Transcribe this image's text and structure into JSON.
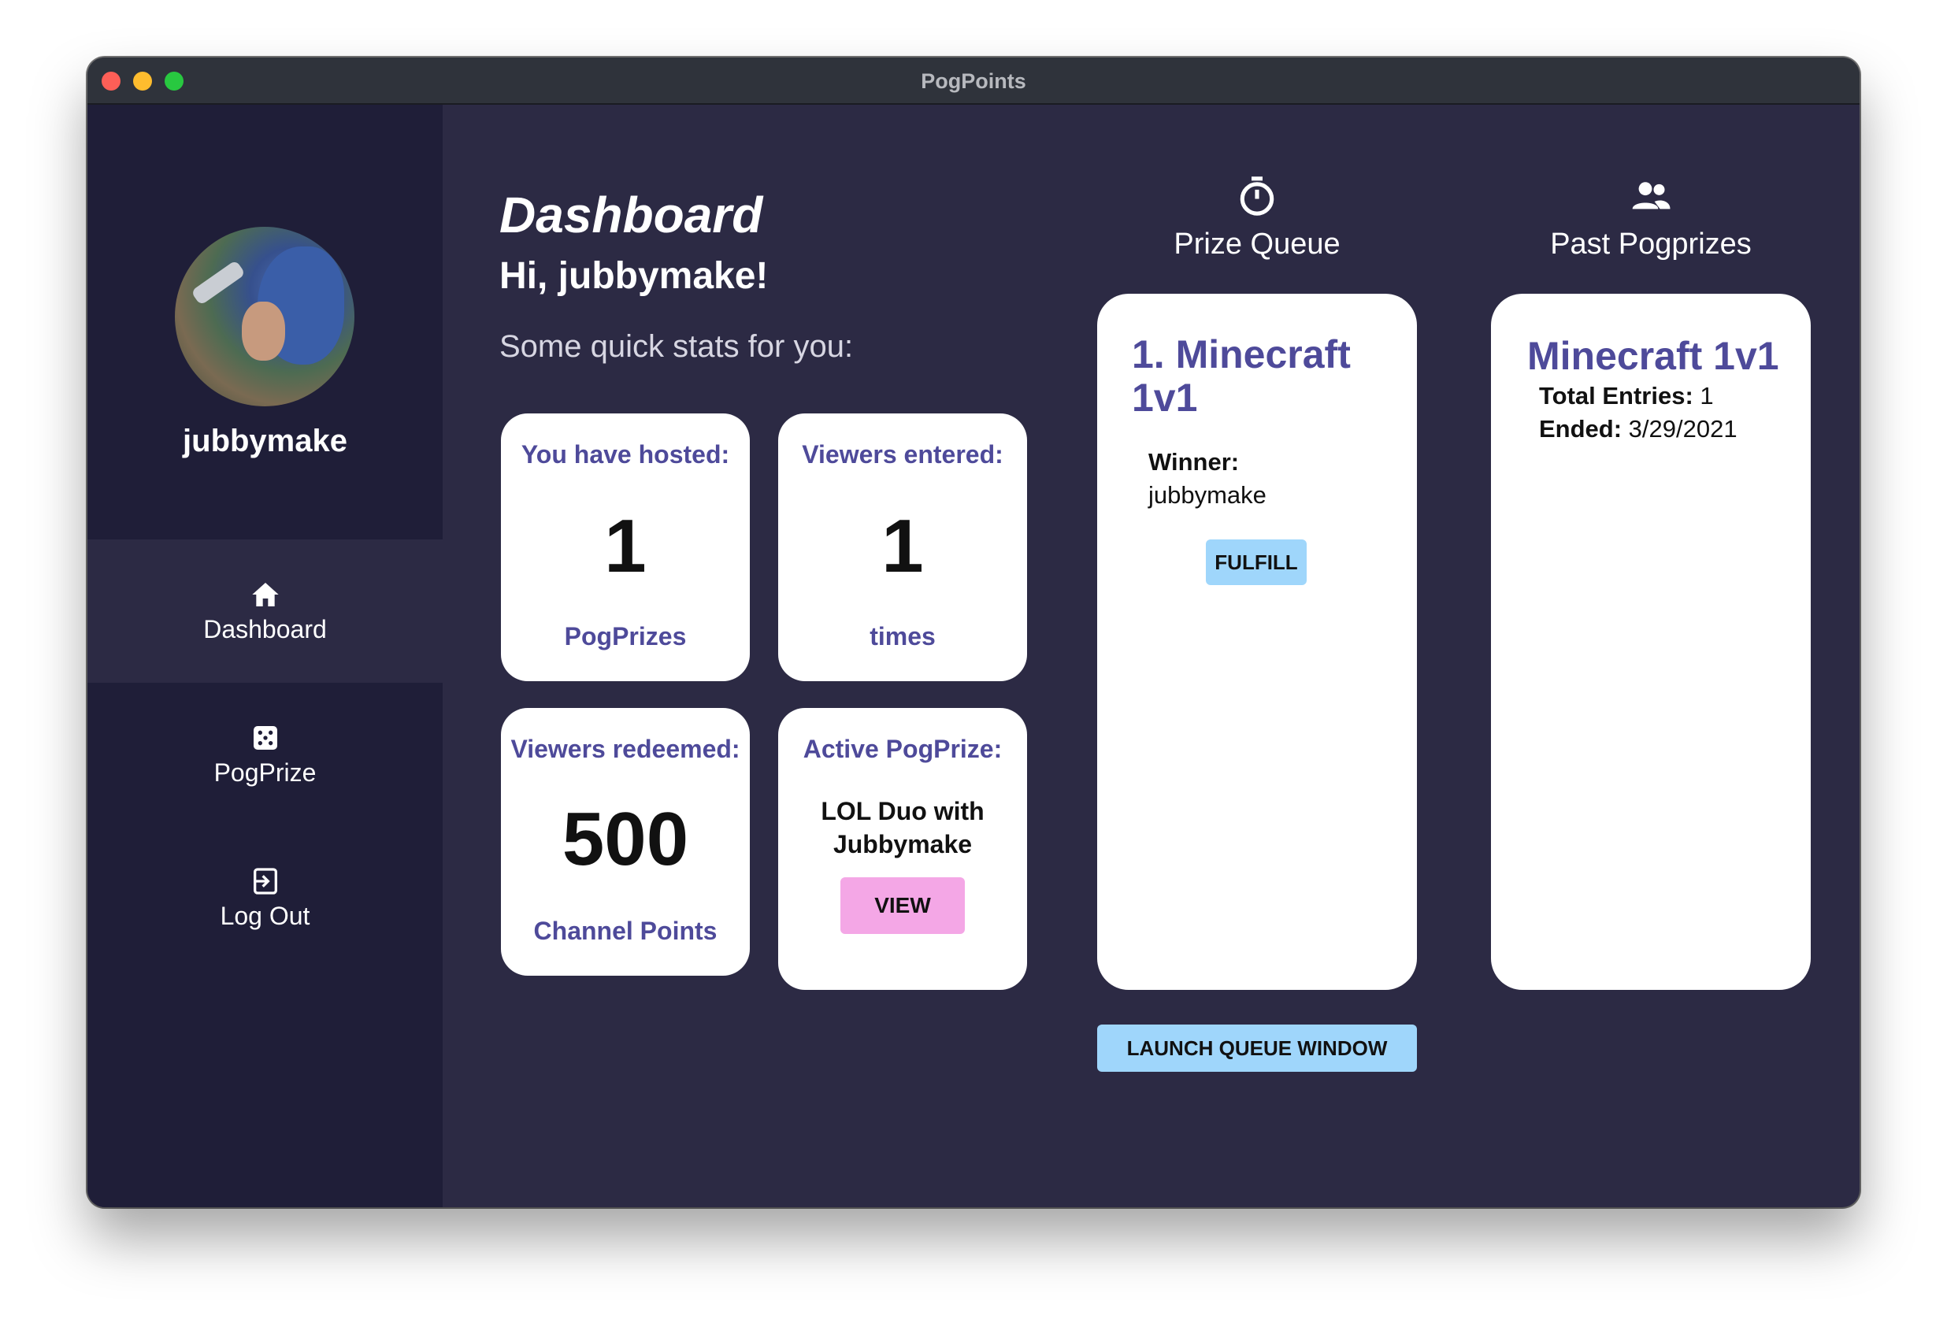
{
  "window": {
    "title": "PogPoints"
  },
  "sidebar": {
    "username": "jubbymake",
    "items": [
      {
        "label": "Dashboard",
        "icon": "home-icon",
        "active": true
      },
      {
        "label": "PogPrize",
        "icon": "dice-icon",
        "active": false
      },
      {
        "label": "Log Out",
        "icon": "logout-icon",
        "active": false
      }
    ]
  },
  "header": {
    "title": "Dashboard",
    "greeting": "Hi, jubbymake!",
    "subtitle": "Some quick stats for you:"
  },
  "stats": {
    "hosted": {
      "title": "You have hosted:",
      "value": "1",
      "unit": "PogPrizes"
    },
    "entered": {
      "title": "Viewers entered:",
      "value": "1",
      "unit": "times"
    },
    "redeemed": {
      "title": "Viewers redeemed:",
      "value": "500",
      "unit": "Channel Points"
    },
    "active": {
      "title": "Active PogPrize:",
      "prize": "LOL Duo with Jubbymake",
      "button": "VIEW"
    }
  },
  "queue": {
    "heading": "Prize Queue",
    "icon": "stopwatch-icon",
    "item_title": "1. Minecraft 1v1",
    "winner_label": "Winner:",
    "winner_value": "jubbymake",
    "fulfill_label": "FULFILL",
    "launch_label": "LAUNCH QUEUE WINDOW"
  },
  "past": {
    "heading": "Past Pogprizes",
    "icon": "users-icon",
    "item_title": "Minecraft 1v1",
    "entries_label": "Total Entries:",
    "entries_value": " 1",
    "ended_label": "Ended:",
    "ended_value": " 3/29/2021"
  },
  "colors": {
    "sidebar_bg": "#1f1e38",
    "main_bg": "#2c2a44",
    "accent": "#4e4a9a",
    "view_button": "#f4a7e6",
    "blue_button": "#9fd6fb"
  }
}
